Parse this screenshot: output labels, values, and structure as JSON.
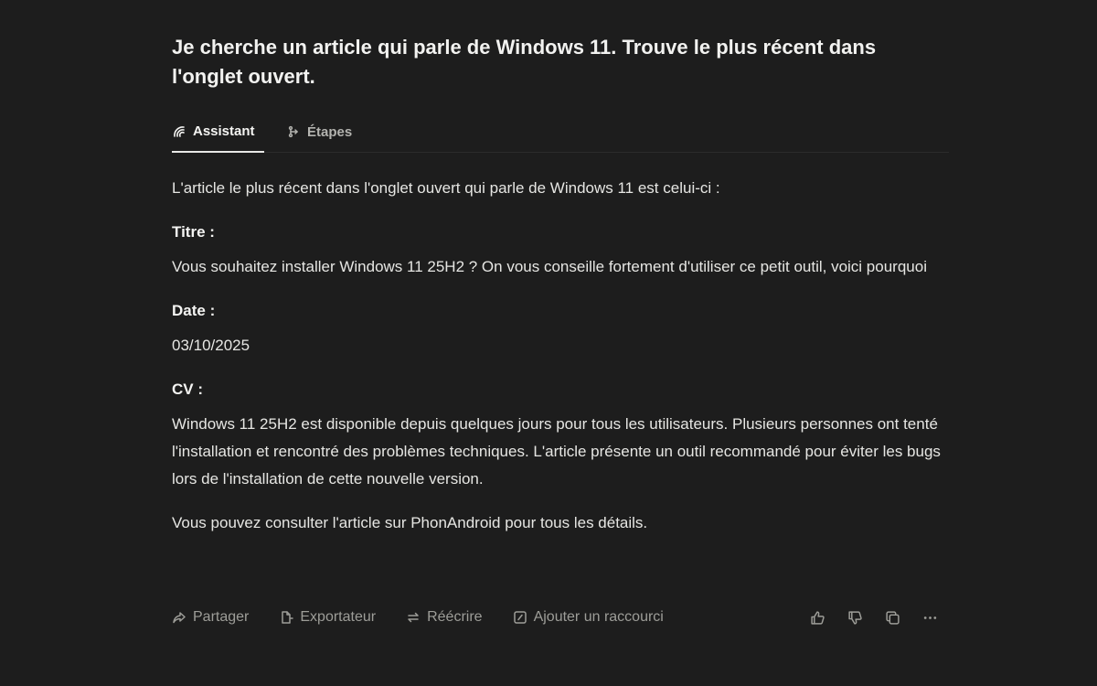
{
  "question": "Je cherche un article qui parle de Windows 11. Trouve le plus récent dans l'onglet ouvert.",
  "tabs": [
    {
      "label": "Assistant",
      "icon": "assistant-icon",
      "active": true
    },
    {
      "label": "Étapes",
      "icon": "steps-icon",
      "active": false
    }
  ],
  "answer": {
    "intro": "L'article le plus récent dans l'onglet ouvert qui parle de Windows 11 est celui-ci :",
    "title_label": "Titre :",
    "title_value": "Vous souhaitez installer Windows 11 25H2 ? On vous conseille fortement d'utiliser ce petit outil, voici pourquoi",
    "date_label": "Date :",
    "date_value": "03/10/2025",
    "cv_label": "CV :",
    "cv_value": "Windows 11 25H2 est disponible depuis quelques jours pour tous les utilisateurs. Plusieurs personnes ont tenté l'installation et rencontré des problèmes techniques. L'article présente un outil recommandé pour éviter les bugs lors de l'installation de cette nouvelle version.",
    "outro": "Vous pouvez consulter l'article sur PhonAndroid pour tous les détails."
  },
  "actions": {
    "share": "Partager",
    "export": "Exportateur",
    "rewrite": "Réécrire",
    "shortcut": "Ajouter un raccourci"
  },
  "icons": [
    "share-icon",
    "export-icon",
    "rewrite-icon",
    "shortcut-icon",
    "thumbs-up-icon",
    "thumbs-down-icon",
    "copy-icon",
    "more-icon"
  ],
  "colors": {
    "background": "#1d1d1d",
    "text": "#e6e6e3",
    "muted": "#9d9d98"
  }
}
